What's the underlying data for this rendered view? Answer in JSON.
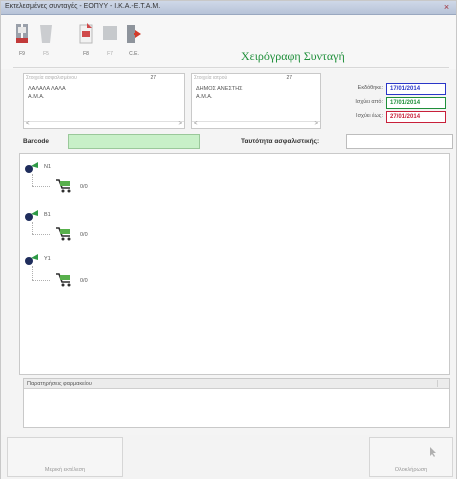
{
  "window": {
    "title": "Εκτελεσμένες συνταγές - ΕΟΠΥΥ - Ι.Κ.Α.-Ε.Τ.Α.Μ.",
    "close_glyph": "×"
  },
  "toolbar": {
    "buttons": [
      {
        "label": "F9",
        "icon": "save-disk-icon",
        "enabled": true
      },
      {
        "label": "F5",
        "icon": "cup-icon",
        "enabled": false
      },
      {
        "label": "F8",
        "icon": "document-red-icon",
        "enabled": true
      },
      {
        "label": "F7",
        "icon": "grey-box-icon",
        "enabled": false
      },
      {
        "label": "C.E.",
        "icon": "exit-door-icon",
        "enabled": true
      }
    ]
  },
  "form_title": "Χειρόγραφη Συνταγή",
  "patient": {
    "header_label": "Στοιχεία ασφαλισμένου",
    "count": "27",
    "line1": "ΛΑΛΑΛΑ ΛΑΛΑ",
    "line2": "Α.Μ.Α.",
    "scroll_left": "<",
    "scroll_right": ">"
  },
  "doctor": {
    "header_label": "Στοιχεία ιατρού",
    "count": "27",
    "line1": "ΔΗΜΟΣ ΑΝΕΣΤΗΣ",
    "line2": "Α.Μ.Α.",
    "scroll_left": "<",
    "scroll_right": ">"
  },
  "dates": [
    {
      "label": "Εκδόθηκε:",
      "value": "17/01/2014",
      "color": "#2a36c8"
    },
    {
      "label": "Ισχύει από:",
      "value": "17/01/2014",
      "color": "#1f8f3a"
    },
    {
      "label": "Ισχύει έως:",
      "value": "27/01/2014",
      "color": "#c8203a"
    }
  ],
  "barcode": {
    "label": "Barcode",
    "value": ""
  },
  "card": {
    "label": "Ταυτότητα ασφαλιστικής:",
    "value": ""
  },
  "tree": {
    "nodes": [
      {
        "label": "Ν1",
        "child": "0/0"
      },
      {
        "label": "Β1",
        "child": "0/0"
      },
      {
        "label": "Υ1",
        "child": "0/0"
      }
    ]
  },
  "notes": {
    "header": "Παρατηρήσεις φαρμακείου"
  },
  "bottom": {
    "left_button": "Μερική εκτέλεση",
    "right_button": "Ολοκλήρωση",
    "right_icon": "cursor-icon"
  }
}
